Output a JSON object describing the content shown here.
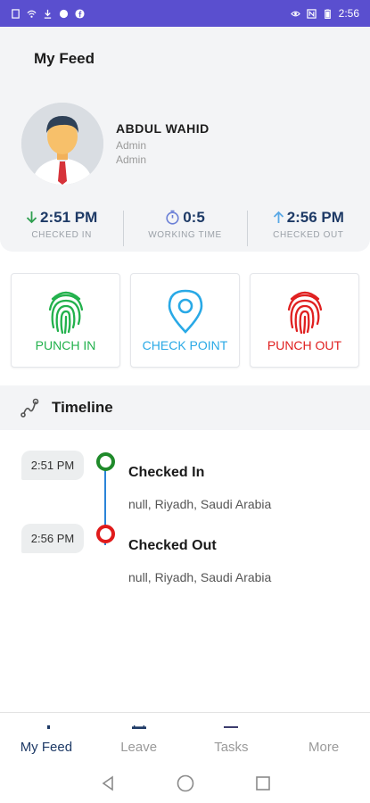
{
  "status_bar": {
    "time": "2:56",
    "left_icons": [
      "document-icon",
      "wifi-icon",
      "download-icon",
      "circle-icon",
      "facebook-icon"
    ],
    "right_icons": [
      "eye-icon",
      "nfc-icon",
      "battery-icon"
    ]
  },
  "header": {
    "title": "My Feed"
  },
  "profile": {
    "name": "ABDUL WAHID",
    "role_line_1": "Admin",
    "role_line_2": "Admin",
    "avatar_icon": "user-avatar-icon"
  },
  "stats": [
    {
      "value": "2:51 PM",
      "label": "CHECKED IN",
      "icon": "arrow-down-icon",
      "icon_color": "#2e9e4f"
    },
    {
      "value": "0:5",
      "label": "WORKING TIME",
      "icon": "stopwatch-icon",
      "icon_color": "#6a7fd6"
    },
    {
      "value": "2:56 PM",
      "label": "CHECKED OUT",
      "icon": "arrow-up-icon",
      "icon_color": "#59a8e6"
    }
  ],
  "actions": [
    {
      "label": "PUNCH IN",
      "icon": "fingerprint-icon",
      "color": "#22b14c"
    },
    {
      "label": "CHECK POINT",
      "icon": "location-pin-icon",
      "color": "#29a9e6"
    },
    {
      "label": "PUNCH OUT",
      "icon": "fingerprint-icon",
      "color": "#e02020"
    }
  ],
  "timeline": {
    "title": "Timeline",
    "icon": "route-icon",
    "events": [
      {
        "time": "2:51 PM",
        "title": "Checked In",
        "location": "null, Riyadh, Saudi Arabia",
        "dot_color": "#1f8a2a"
      },
      {
        "time": "2:56 PM",
        "title": "Checked Out",
        "location": "null, Riyadh, Saudi Arabia",
        "dot_color": "#e01b1b"
      }
    ],
    "line_color": "#2b84d8"
  },
  "bottom_nav": [
    {
      "label": "My Feed",
      "active": true
    },
    {
      "label": "Leave",
      "active": false
    },
    {
      "label": "Tasks",
      "active": false
    },
    {
      "label": "More",
      "active": false
    }
  ],
  "system_nav": [
    "back-icon",
    "home-icon",
    "recents-icon"
  ],
  "colors": {
    "status_bar": "#5a4fcf",
    "primary_text": "#1e3a66",
    "panel_bg": "#f3f4f6"
  }
}
